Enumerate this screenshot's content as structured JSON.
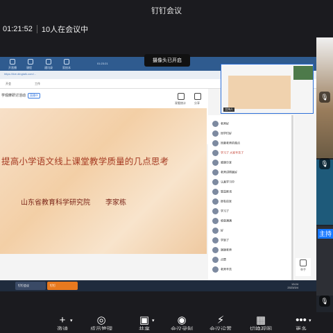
{
  "window": {
    "title": "钉钉会议"
  },
  "status": {
    "elapsed": "01:21:52",
    "participants": "10人在会议中"
  },
  "camera_tooltip": "摄像头已开启",
  "browser": {
    "url": "https://live.dingtalk.com/...",
    "tabs": [
      "开直播",
      "课程",
      "通讯录",
      "家校本",
      "开会",
      "工作"
    ],
    "clock": "01:23:21"
  },
  "live": {
    "title": "学观摩研讨活动",
    "tag": "直播中",
    "actions": [
      "观看统计",
      "分享"
    ]
  },
  "slide": {
    "title": "提高小学语文线上课堂教学质量的几点思考",
    "org": "山东省教育科学研究院",
    "author": "李家栋"
  },
  "chat_messages": [
    {
      "text": "老师好",
      "red": false
    },
    {
      "text": "同学们好",
      "red": false
    },
    {
      "text": "同意老师的观点",
      "red": false
    },
    {
      "text": "学习了 大家辛苦了",
      "red": true
    },
    {
      "text": "感谢分享",
      "red": false
    },
    {
      "text": "老师讲得真好",
      "red": false
    },
    {
      "text": "认真学习中",
      "red": false
    },
    {
      "text": "受益匪浅",
      "red": false
    },
    {
      "text": "很有启发",
      "red": false
    },
    {
      "text": "学习了",
      "red": false
    },
    {
      "text": "收获满满",
      "red": false
    },
    {
      "text": "好",
      "red": false
    },
    {
      "text": "学到了",
      "red": false
    },
    {
      "text": "谢谢老师",
      "red": false
    },
    {
      "text": "点赞",
      "red": false
    },
    {
      "text": "老师辛苦",
      "red": false
    }
  ],
  "hand_label": "举手",
  "taskbar": {
    "items": [
      "钉钉会议",
      "钉钉"
    ],
    "time": "13:24",
    "date": "2023/3/4"
  },
  "preview": {
    "name": "主持人"
  },
  "host_badge": "主持",
  "toolbar": [
    {
      "label": "邀请",
      "icon": "person-add-icon",
      "glyph": "+",
      "caret": true
    },
    {
      "label": "成员管理",
      "icon": "members-icon",
      "glyph": "◎",
      "caret": false
    },
    {
      "label": "共享",
      "icon": "share-screen-icon",
      "glyph": "▣",
      "caret": true
    },
    {
      "label": "会议录制",
      "icon": "record-icon",
      "glyph": "◉",
      "caret": false
    },
    {
      "label": "会议设置",
      "icon": "settings-icon",
      "glyph": "⚡",
      "caret": false
    },
    {
      "label": "切换视图",
      "icon": "grid-view-icon",
      "glyph": "▦",
      "caret": false
    },
    {
      "label": "更多",
      "icon": "more-icon",
      "glyph": "•••",
      "caret": true
    }
  ]
}
